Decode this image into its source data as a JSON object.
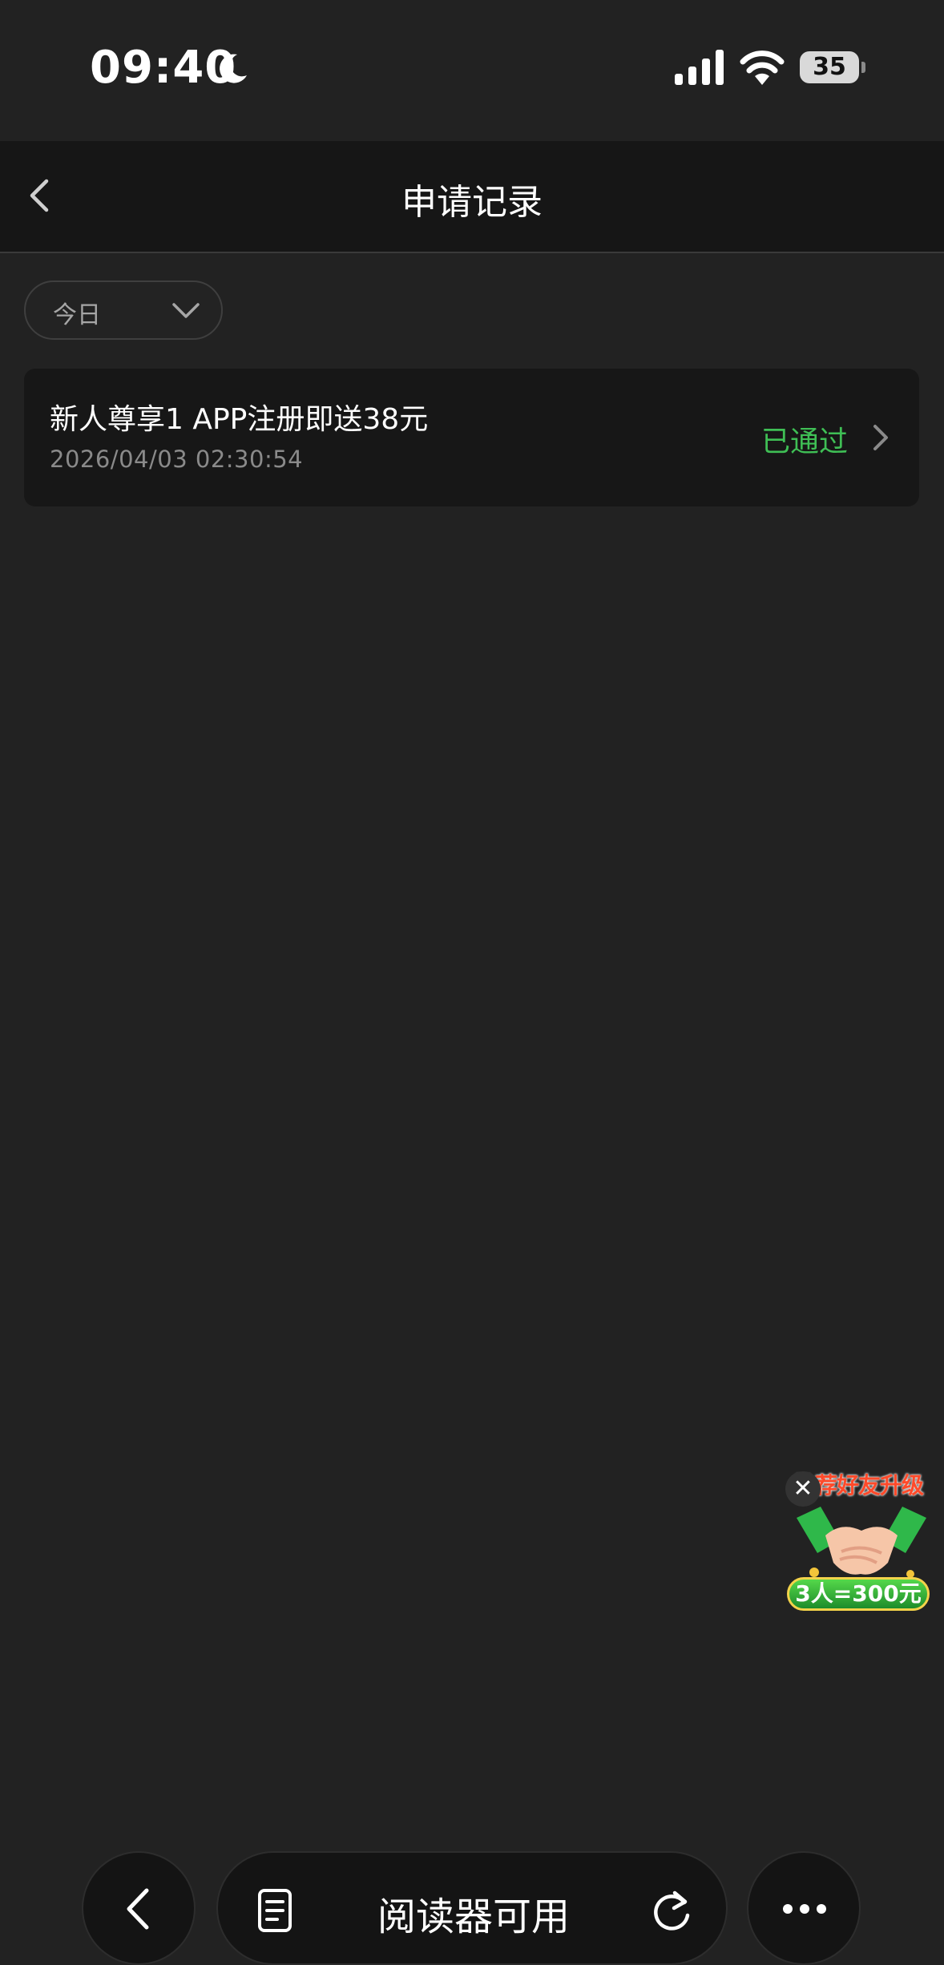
{
  "status_bar": {
    "time": "09:40",
    "battery_level": "35"
  },
  "nav": {
    "title": "申请记录"
  },
  "filter": {
    "selected": "今日"
  },
  "records": [
    {
      "title": "新人尊享1 APP注册即送38元",
      "time": "2026/04/03 02:30:54",
      "status": "已通过"
    }
  ],
  "promo": {
    "banner": "推荐好友升级",
    "reward": "3人=300元",
    "close_glyph": "✕"
  },
  "toolbar": {
    "address_text": "阅读器可用"
  },
  "colors": {
    "background": "#222222",
    "nav_background": "#161616",
    "card_background": "#171717",
    "status_green": "#3fbf55",
    "promo_red": "#ff4a2a"
  },
  "icons": {
    "status": [
      "moon-icon",
      "signal-icon",
      "wifi-icon",
      "battery-icon"
    ],
    "nav": [
      "back-chevron-icon"
    ],
    "toolbar": [
      "back-chevron-icon",
      "reader-icon",
      "reload-icon",
      "more-icon"
    ]
  }
}
